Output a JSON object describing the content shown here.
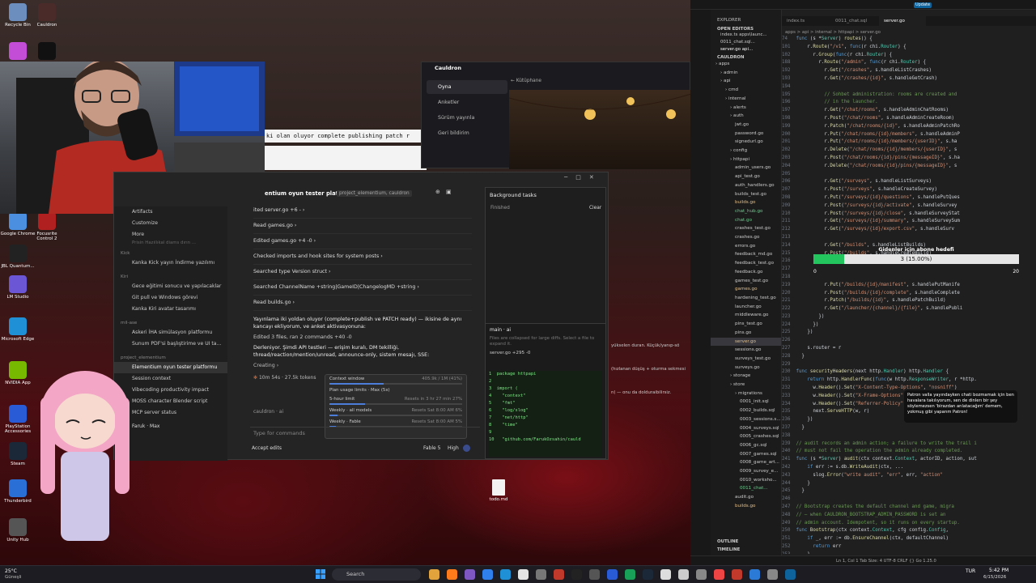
{
  "desktop": {
    "icons": [
      {
        "label": "Recycle Bin",
        "color": "#6c8ebf"
      },
      {
        "label": "Cauldron",
        "color": "#4b2a2a"
      },
      {
        "label": "",
        "color": "#c34dd6"
      },
      {
        "label": "",
        "color": "#111111"
      },
      {
        "label": "Google Chrome",
        "color": "#4a8fe0"
      },
      {
        "label": "Focusrite Control 2",
        "color": "#b02020"
      },
      {
        "label": "JBL Quantum...",
        "color": "#222222"
      },
      {
        "label": "LM Studio",
        "color": "#6b57d6"
      },
      {
        "label": "Microsoft Edge",
        "color": "#1f8fd6"
      },
      {
        "label": "NVIDIA App",
        "color": "#76b900"
      },
      {
        "label": "PlayStation Accessories",
        "color": "#2a5bd7"
      },
      {
        "label": "Steam",
        "color": "#1b2838"
      },
      {
        "label": "Thunderbird",
        "color": "#2a6fd6"
      },
      {
        "label": "Unity Hub",
        "color": "#555555"
      }
    ],
    "file_label": "todo.md"
  },
  "partial_text": "ki olan oluyor complete publishing patch r",
  "cauldron": {
    "title": "Cauldron",
    "menu": [
      "Oyna",
      "Anketler",
      "Sürüm yayınla",
      "Geri bildirim"
    ],
    "breadcrumb": "← Kütüphane",
    "side_text": [
      "yükselen duran. Küçük/yanıp-sö",
      "(hızlanan düşüş + oturma sekmesi",
      "n) — onu da dolduraibilirsiz."
    ]
  },
  "claude": {
    "sidebar": {
      "top": [
        "Artifacts",
        "Customize",
        "More"
      ],
      "partial": "Prisin Hazıllıkal diams dırın ...",
      "kick_header": "Kick",
      "kick_items": [
        "Kanka Kick yayın İndirme yazılımı"
      ],
      "kiri_header": "Kiri",
      "kiri_items": [
        "Gece eğitimi sonucu ve yapılacaklar",
        "Git pull ve Windows görevi",
        "Kanka Kiri avatar tasarımı"
      ],
      "mil_header": "mil-ase",
      "mil_items": [
        "Askeri İHA simülasyon platformu",
        "Sunum PDF'si başlıştirime ve UI ta..."
      ],
      "proj_header": "project_elementium",
      "proj_items": [
        "Elementium oyun tester platformu",
        "Session context",
        "Vibecoding productivity impact",
        "MOSS character Blender script",
        "MCP server status"
      ],
      "user": "Faruk",
      "plan": "Max"
    },
    "header": {
      "title": "entium oyun tester platformu",
      "tag": "project_elementium, cauldron"
    },
    "steps": [
      "ited server.go +6 -",
      "Read games.go",
      "Edited games.go +4 -0",
      "Checked imports and hook sites for system posts",
      "Searched type Version struct",
      "Searched ChannelName +string|GameID|ChangelogMD +string",
      "Read builds.go"
    ],
    "message": "Yayınlama iki yoldan oluyor (complete+publish ve PATCH ready) — ikisine de aynı kancayı ekliyorum, ve anket aktivasyonuna:",
    "edited_summary": "Edited 3 files, ran 2 commands +40 -0",
    "deriving": "Derleniyor. Şimdi API testleri — erişim kuralı, DM tekilliği, thread/reaction/mention/unread, announce-only, sistem mesajı, SSE:",
    "status": "Creating",
    "stats": "10m 54s · 27.5k tokens",
    "branch": "cauldron · ai",
    "placeholder": "Type for commands",
    "accept": "Accept edits",
    "model": "Fable 5",
    "effort": "High",
    "usage": [
      {
        "label": "Context window",
        "value": "405.9k / 1M (41%)",
        "fill": 0.41
      },
      {
        "label": "Plan usage limits · Max (5x)",
        "value": "",
        "fill": 0
      },
      {
        "label": "5-hour limit",
        "value": "Resets in 3 hr 27 min  27%",
        "fill": 0.27
      },
      {
        "label": "Weekly · all models",
        "value": "Resets Sat 8:00 AM  6%",
        "fill": 0.06
      },
      {
        "label": "Weekly · Fable",
        "value": "Resets Sat 8:00 AM  5%",
        "fill": 0.05
      }
    ],
    "bg_tasks": {
      "title": "Background tasks",
      "finished": "Finished",
      "clear": "Clear"
    },
    "diff": {
      "title": "main · ai",
      "note": "Files are collapsed for large diffs. Select a file to expand it.",
      "file": "server.go +295 -0"
    }
  },
  "overlay": {
    "sub_goal": "Gidenler için abone hedefi",
    "progress_text": "3 (15.00%)",
    "progress": 0.15,
    "min": "0",
    "max": "20",
    "chat": "Patron valla yayındayken chati bozmamak için ben havalara takılıyorum, sen de dinlerı bir şey söylemezsen 'birazdan anlatacağım' demem, yokmuş gibi yaparım Patron!"
  },
  "vscode": {
    "tabs": [
      "index.ts",
      "0011_chat.sql",
      "server.go"
    ],
    "explorer": "EXPLORER",
    "open_editors": "OPEN EDITORS",
    "root": "CAULDRON",
    "open_files": [
      "index.ts  apps\\launc...",
      "0011_chat.sql...",
      "server.go  api..."
    ],
    "breadcrumb": "apps > api > internal > httpapi > server.go",
    "tree": [
      "apps",
      "admin",
      "api",
      "cmd",
      "internal",
      "alerts",
      "auth",
      "jwt.go",
      "password.go",
      "signedurl.go",
      "config",
      "httpapi",
      "admin_users.go",
      "api_test.go",
      "auth_handlers.go",
      "builds_test.go",
      "builds.go",
      "chat_hub.go",
      "chat.go",
      "crashes_test.go",
      "crashes.go",
      "errors.go",
      "feedback_md.go",
      "feedback_test.go",
      "feedback.go",
      "games_test.go",
      "games.go",
      "hardening_test.go",
      "launcher.go",
      "middleware.go",
      "pins_test.go",
      "pins.go",
      "server.go",
      "sessions.go",
      "surveys_test.go",
      "surveys.go",
      "storage",
      "store",
      "migrations",
      "0001_init.sql",
      "0002_builds.sql",
      "0003_sessions.s...",
      "0004_surveys.sql",
      "0005_crashes.sql",
      "0006_gc.sql",
      "0007_games.sql",
      "0008_game_art...",
      "0009_survey_e...",
      "0010_worksho...",
      "0011_chat...",
      "audit.go",
      "builds.go"
    ],
    "outline": "OUTLINE",
    "timeline": "TIMELINE",
    "status": "Ln 1, Col 1   Tab Size: 4   UTF-8   CRLF   {} Go   1.25.0"
  },
  "taskbar": {
    "weather": "25°C",
    "weather_sub": "Güneşli",
    "search": "Search",
    "lang": "TUR",
    "time": "5:42 PM",
    "date": "6/15/2026"
  }
}
